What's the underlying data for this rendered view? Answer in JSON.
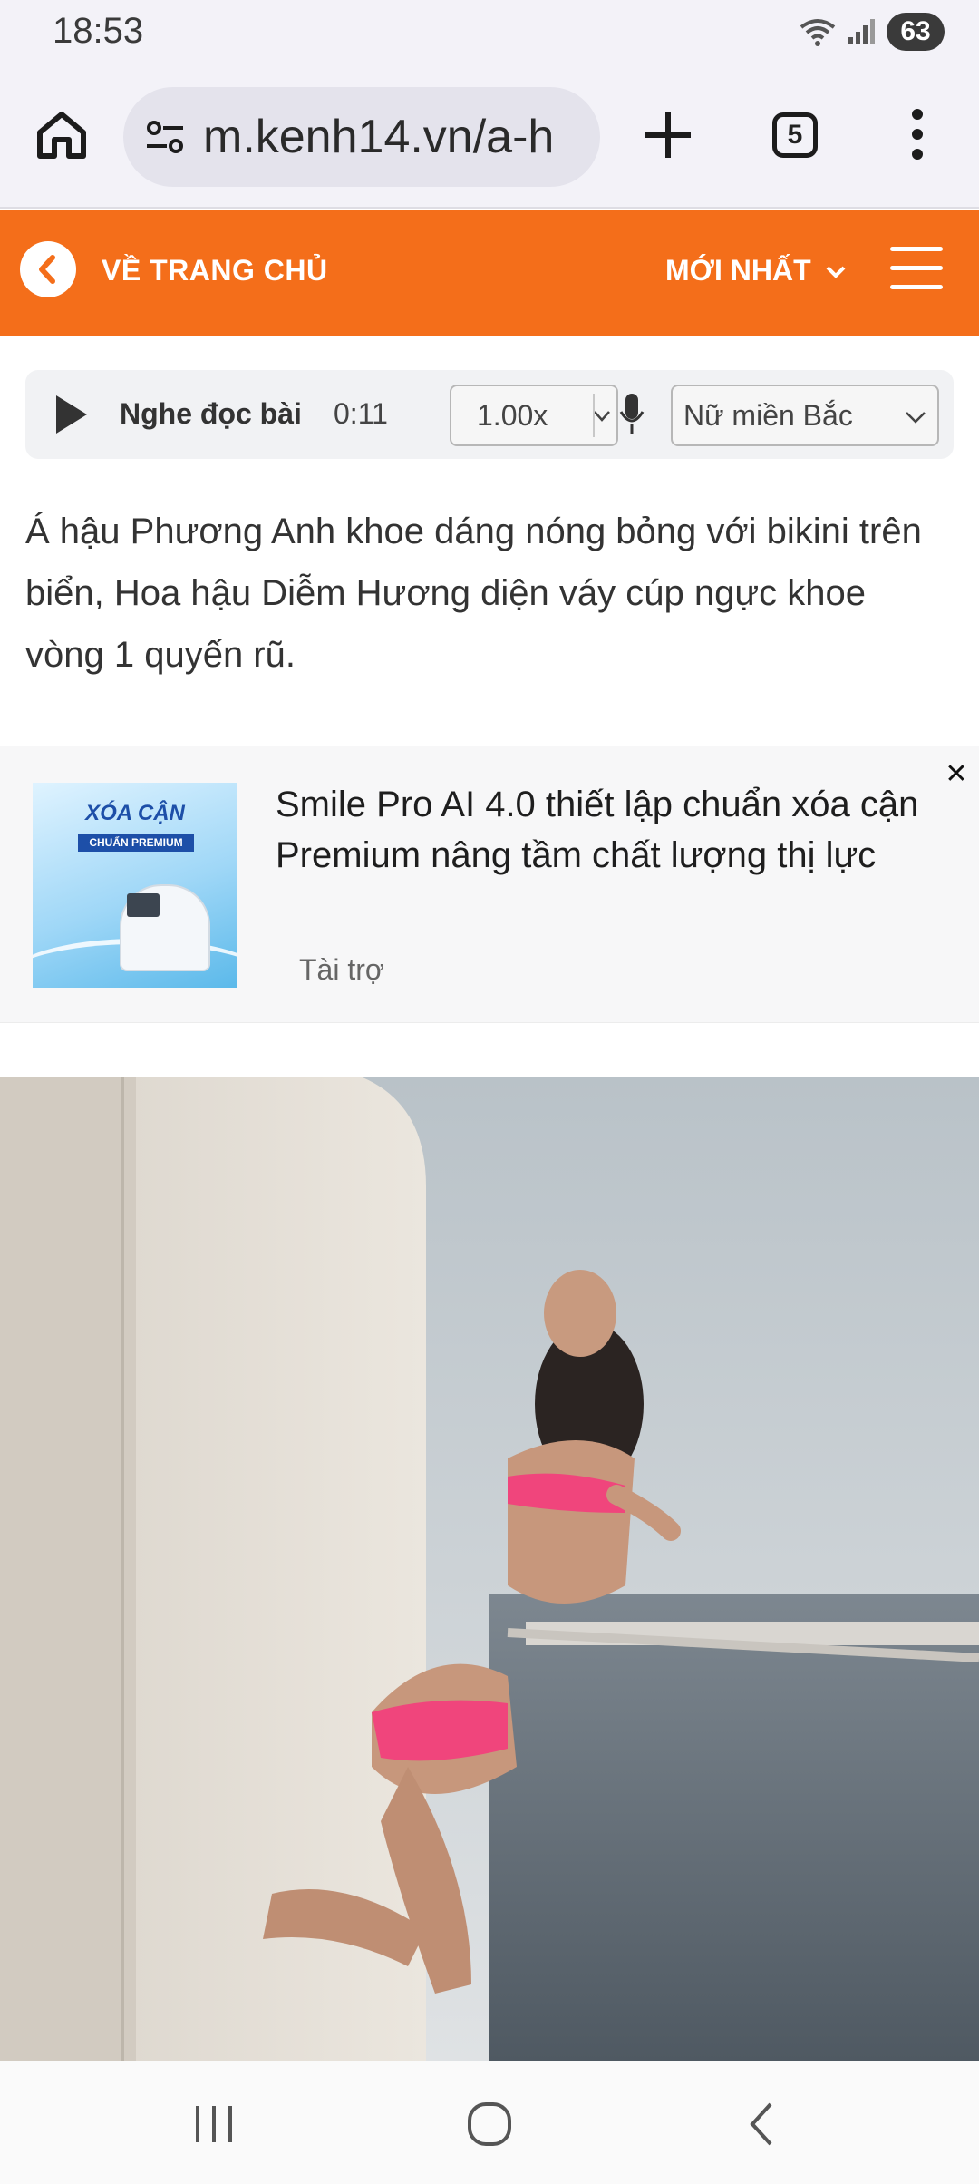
{
  "status_bar": {
    "time": "18:53",
    "battery": "63",
    "icons": [
      "wifi-icon",
      "signal-icon",
      "battery-icon"
    ]
  },
  "browser": {
    "url": "m.kenh14.vn/a-h",
    "tab_count": "5",
    "icons": [
      "home-icon",
      "site-settings-icon",
      "new-tab-icon",
      "tabs-icon",
      "more-options-icon"
    ]
  },
  "site_header": {
    "home_label": "VỀ TRANG CHỦ",
    "newest_label": "MỚI NHẤT",
    "brand_color": "#f46e1a"
  },
  "audio_player": {
    "label": "Nghe đọc bài",
    "time": "0:11",
    "speed": "1.00x",
    "voice": "Nữ miền Bắc"
  },
  "article": {
    "summary": "Á hậu Phương Anh khoe dáng nóng bỏng với bikini trên biển, Hoa hậu Diễm Hương diện váy cúp ngực khoe vòng 1 quyến rũ."
  },
  "ad": {
    "title": "Smile Pro AI 4.0 thiết lập chuẩn xóa cận Premium nâng tầm chất lượng thị lực",
    "label": "Tài trợ",
    "image_title": "XÓA CẬN",
    "image_badge": "CHUẨN PREMIUM",
    "close_symbol": "✕"
  },
  "nav_bar": {
    "icons": [
      "recent-apps-icon",
      "home-circle-icon",
      "back-icon"
    ]
  }
}
